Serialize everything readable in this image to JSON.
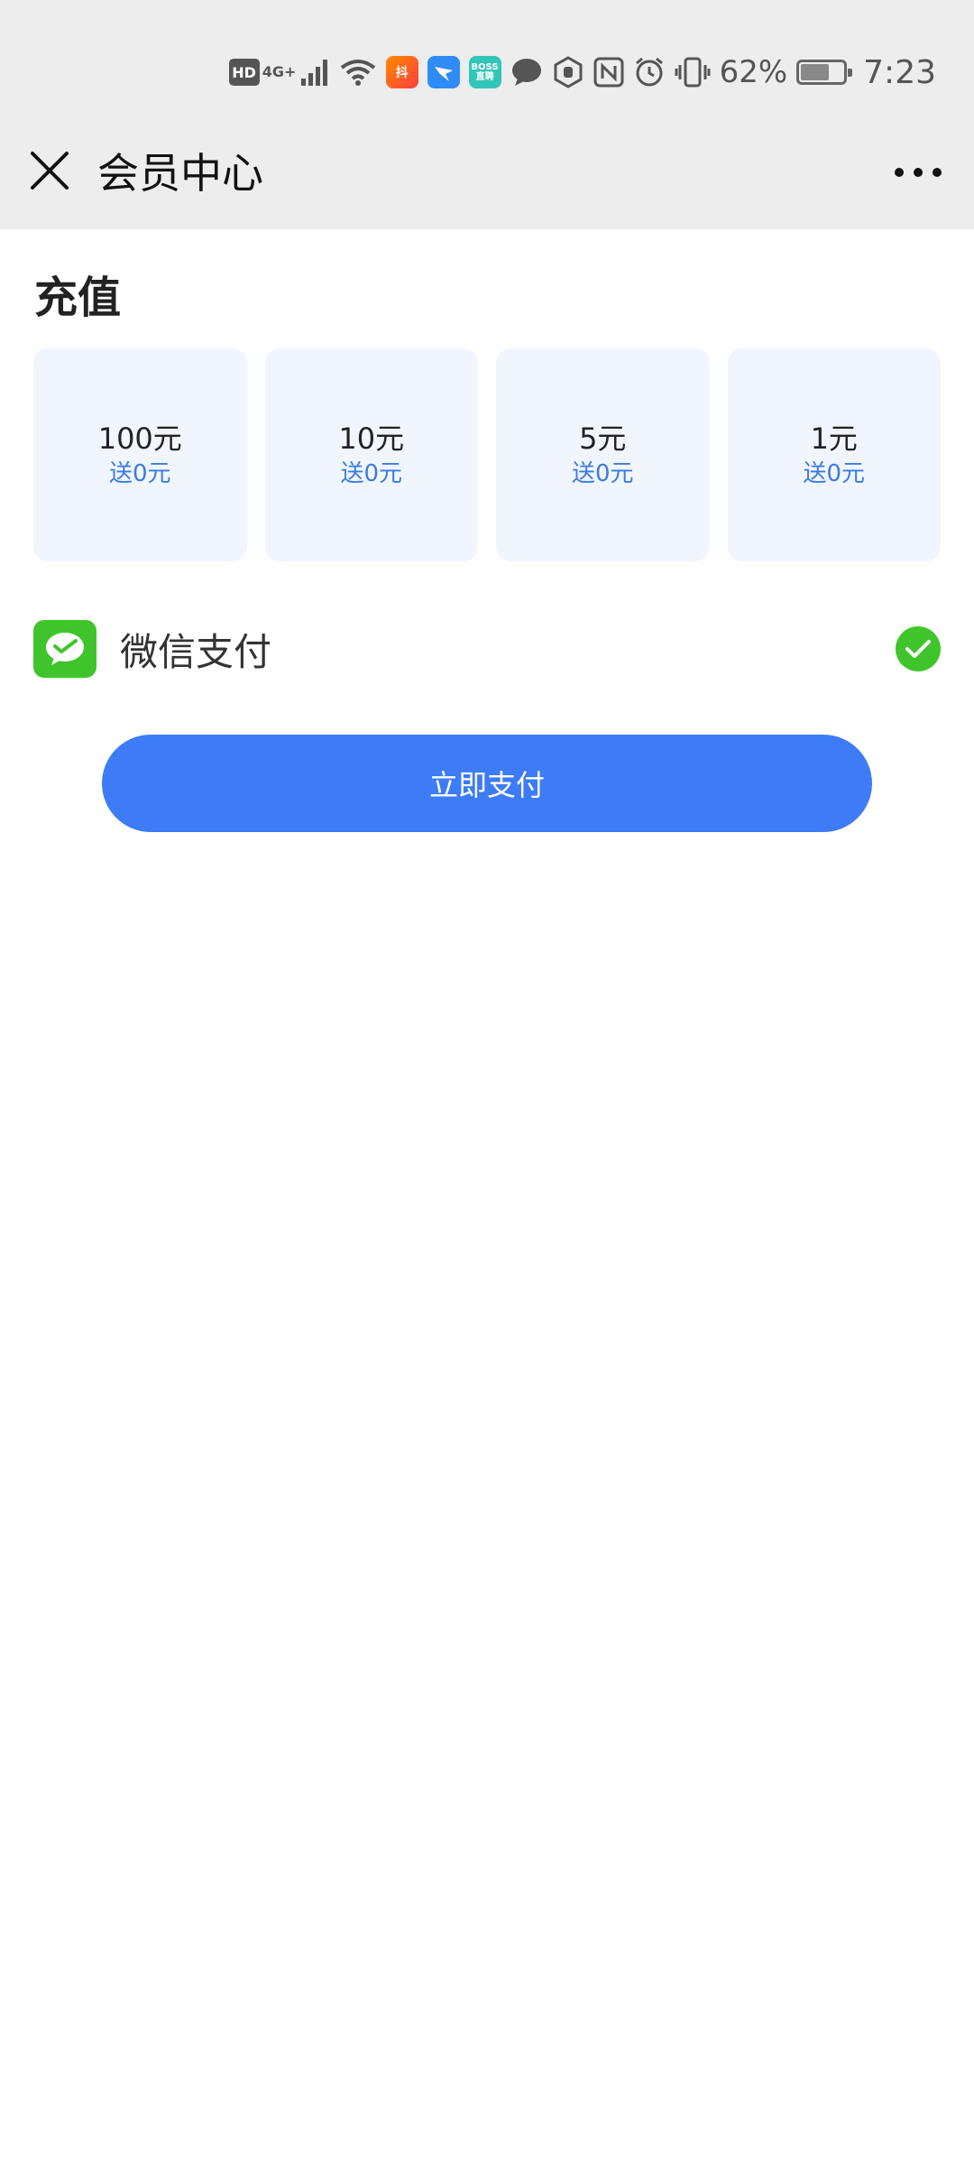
{
  "status_bar": {
    "hd": "HD",
    "network": "4G+",
    "app_badge_1": "抖",
    "app_badge_3": "BOSS直聘",
    "battery_percent": "62%",
    "battery_level": 0.62,
    "time": "7:23",
    "icons": [
      "hd-icon",
      "4g-signal-icon",
      "wifi-icon",
      "app-orange-icon",
      "dingtalk-icon",
      "boss-icon",
      "chat-bubble-icon",
      "hand-icon",
      "nfc-icon",
      "alarm-icon",
      "vibrate-icon",
      "battery-icon"
    ]
  },
  "nav": {
    "title": "会员中心",
    "close_icon": "close-icon",
    "more_icon": "more-icon"
  },
  "recharge": {
    "title": "充值",
    "options": [
      {
        "amount": "100元",
        "bonus": "送0元"
      },
      {
        "amount": "10元",
        "bonus": "送0元"
      },
      {
        "amount": "5元",
        "bonus": "送0元"
      },
      {
        "amount": "1元",
        "bonus": "送0元"
      }
    ]
  },
  "payment": {
    "method_label": "微信支付",
    "selected": true,
    "icon": "wechat-pay-icon"
  },
  "pay_button": {
    "label": "立即支付"
  },
  "colors": {
    "accent": "#3d7cf6",
    "wechat_green": "#3fc52b",
    "bonus_text": "#3d7bdf",
    "card_bg": "#f1f6fe",
    "header_bg": "#ededed"
  }
}
